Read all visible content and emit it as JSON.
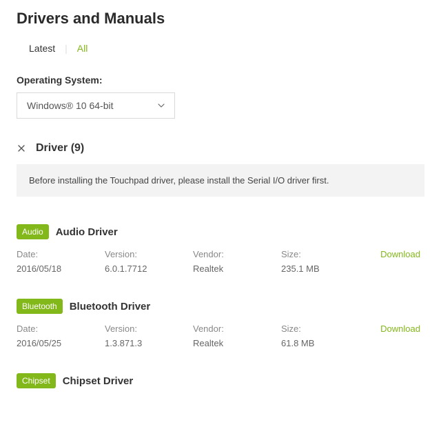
{
  "page_title": "Drivers and Manuals",
  "tabs": {
    "latest": "Latest",
    "all": "All"
  },
  "os_label": "Operating System:",
  "os_selected": "Windows® 10 64-bit",
  "section_heading": "Driver (9)",
  "notice": "Before installing the Touchpad driver, please install the Serial I/O driver first.",
  "col_labels": {
    "date": "Date:",
    "version": "Version:",
    "vendor": "Vendor:",
    "size": "Size:"
  },
  "download_label": "Download",
  "drivers": [
    {
      "category": "Audio",
      "title": "Audio Driver",
      "date": "2016/05/18",
      "version": "6.0.1.7712",
      "vendor": "Realtek",
      "size": "235.1 MB"
    },
    {
      "category": "Bluetooth",
      "title": "Bluetooth Driver",
      "date": "2016/05/25",
      "version": "1.3.871.3",
      "vendor": "Realtek",
      "size": "61.8 MB"
    },
    {
      "category": "Chipset",
      "title": "Chipset Driver"
    }
  ]
}
